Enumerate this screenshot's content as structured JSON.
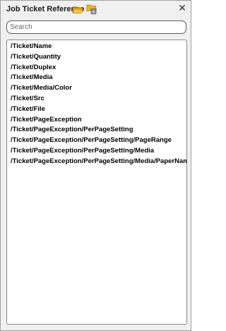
{
  "header": {
    "title": "Job Ticket Reference",
    "icons": [
      "open-folder-icon",
      "folder-delete-icon",
      "close-icon"
    ],
    "close_glyph": "✕"
  },
  "search": {
    "placeholder": "Search",
    "value": ""
  },
  "list": {
    "items": [
      "/Ticket/Name",
      "/Ticket/Quantity",
      "/Ticket/Duplex",
      "/Ticket/Media",
      "/Ticket/Media/Color",
      "/Ticket/Src",
      "/Ticket/File",
      "/Ticket/PageException",
      "/Ticket/PageException/PerPageSetting",
      "/Ticket/PageException/PerPageSetting/PageRange",
      "/Ticket/PageException/PerPageSetting/Media",
      "/Ticket/PageException/PerPageSetting/Media/PaperName"
    ]
  },
  "colors": {
    "folder": "#f0b429",
    "folder_dark": "#c98a10",
    "panel_bg": "#f0f0f0",
    "border": "#a0a0a0"
  }
}
